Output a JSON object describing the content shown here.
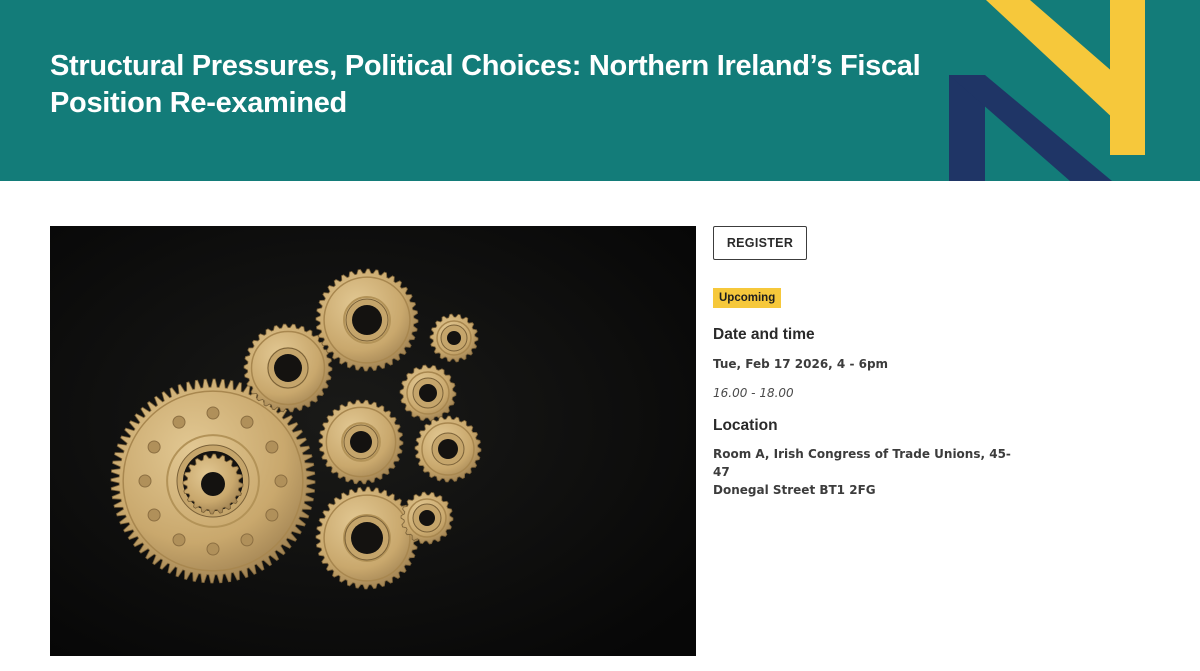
{
  "event": {
    "title": "Structural Pressures, Political Choices: Northern Ireland’s Fiscal Position Re-examined",
    "register_label": "REGISTER",
    "status": "Upcoming",
    "date_heading": "Date and time",
    "date_value": "Tue, Feb 17 2026, 4 - 6pm",
    "time_note": "16.00 - 18.00",
    "location_heading": "Location",
    "location_lines": [
      "Room A, Irish Congress of Trade Unions, 45-47",
      "Donegal Street BT1 2FG"
    ]
  },
  "colors": {
    "banner": "#137c79",
    "accent_yellow": "#f6c83b",
    "accent_navy": "#1f3566"
  },
  "image": {
    "subject": "brass gears on black background"
  }
}
